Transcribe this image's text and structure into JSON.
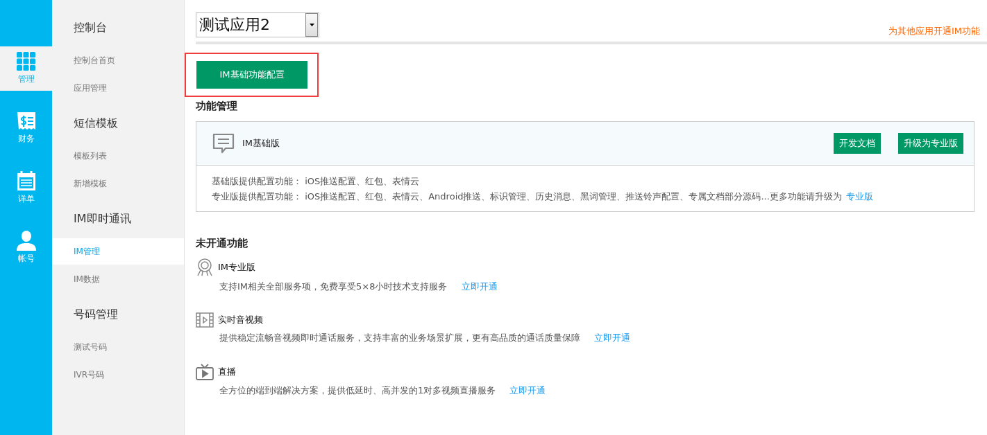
{
  "rail": [
    {
      "kind": "grid",
      "label": "管理",
      "selected": true
    },
    {
      "kind": "bill",
      "label": "财务",
      "selected": false
    },
    {
      "kind": "calendar",
      "label": "详单",
      "selected": false
    },
    {
      "kind": "user",
      "label": "帐号",
      "selected": false
    }
  ],
  "sidebar": {
    "sections": [
      {
        "title": "控制台",
        "items": [
          {
            "label": "控制台首页",
            "selected": false
          },
          {
            "label": "应用管理",
            "selected": false
          }
        ]
      },
      {
        "title": "短信模板",
        "items": [
          {
            "label": "模板列表",
            "selected": false
          },
          {
            "label": "新增模板",
            "selected": false
          }
        ]
      },
      {
        "title": "IM即时通讯",
        "items": [
          {
            "label": "IM管理",
            "selected": true
          },
          {
            "label": "IM数据",
            "selected": false
          }
        ]
      },
      {
        "title": "号码管理",
        "items": [
          {
            "label": "测试号码",
            "selected": false
          },
          {
            "label": "IVR号码",
            "selected": false
          }
        ]
      }
    ]
  },
  "app_select": {
    "value": "测试应用2"
  },
  "top_link": "为其他应用开通IM功能",
  "config_button": {
    "label": "IM基础功能配置",
    "highlighted": true
  },
  "feature_management": {
    "title": "功能管理",
    "card": {
      "name": "IM基础版",
      "buttons": [
        "开发文档",
        "升级为专业版"
      ],
      "basic_line": "基础版提供配置功能： iOS推送配置、红包、表情云",
      "pro_line": "专业版提供配置功能： iOS推送配置、红包、表情云、Android推送、标识管理、历史消息、黑词管理、推送铃声配置、专属文档部分源码...更多功能请升级为",
      "pro_link": "专业版"
    }
  },
  "inactive_features": {
    "title": "未开通功能",
    "items": [
      {
        "kind": "medal",
        "name": "IM专业版",
        "description": "支持IM相关全部服务项，免费享受5×8小时技术支持服务",
        "action": "立即开通"
      },
      {
        "kind": "film",
        "name": "实时音视频",
        "description": "提供稳定流畅音视频即时通话服务，支持丰富的业务场景扩展，更有高品质的通话质量保障",
        "action": "立即开通"
      },
      {
        "kind": "tv",
        "name": "直播",
        "description": "全方位的端到端解决方案，提供低延时、高并发的1对多视频直播服务",
        "action": "立即开通"
      }
    ]
  }
}
